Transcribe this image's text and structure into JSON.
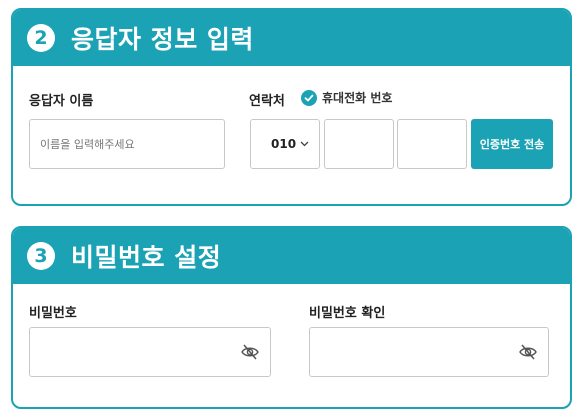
{
  "section1": {
    "number": "2",
    "title": "응답자 정보 입력",
    "name_label": "응답자 이름",
    "name_placeholder": "이름을 입력해주세요",
    "contact_label": "연락처",
    "verified_text": "휴대전화 번호",
    "phone_prefix": "010",
    "phone_mid": "",
    "phone_last": "",
    "send_button": "인증번호 전송"
  },
  "section2": {
    "number": "3",
    "title": "비밀번호 설정",
    "password_label": "비밀번호",
    "confirm_label": "비밀번호 확인"
  },
  "colors": {
    "accent": "#1ba3b5",
    "border": "#c8c8c8"
  },
  "icons": {
    "check": "check-circle-icon",
    "eye": "eye-off-icon",
    "chevron": "chevron-down-icon"
  }
}
